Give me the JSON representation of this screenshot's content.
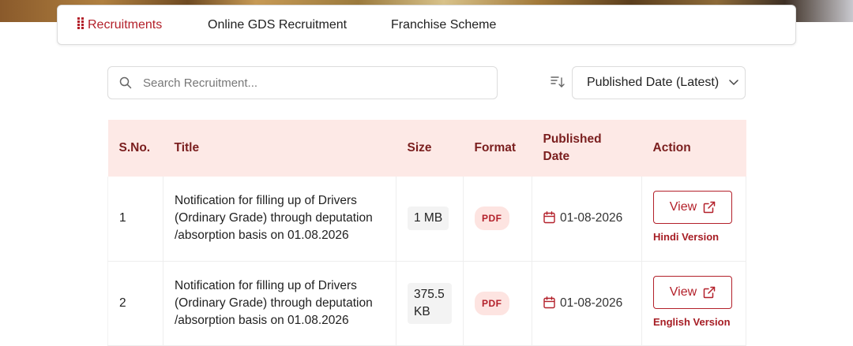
{
  "tabs": [
    {
      "label": "Recruitments",
      "active": true
    },
    {
      "label": "Online GDS Recruitment",
      "active": false
    },
    {
      "label": "Franchise Scheme",
      "active": false
    }
  ],
  "search": {
    "placeholder": "Search Recruitment...",
    "value": ""
  },
  "sort": {
    "selected": "Published Date (Latest)"
  },
  "table": {
    "headers": {
      "sno": "S.No.",
      "title": "Title",
      "size": "Size",
      "format": "Format",
      "published_date": "Published Date",
      "action": "Action"
    },
    "rows": [
      {
        "sno": "1",
        "title": "Notification for filling up of Drivers (Ordinary Grade) through deputation /absorption basis on 01.08.2026",
        "size": "1 MB",
        "format": "PDF",
        "date": "01-08-2026",
        "action_label": "View",
        "version": "Hindi Version"
      },
      {
        "sno": "2",
        "title": "Notification for filling up of Drivers (Ordinary Grade) through deputation /absorption basis on 01.08.2026",
        "size": "375.5 KB",
        "format": "PDF",
        "date": "01-08-2026",
        "action_label": "View",
        "version": "English Version"
      }
    ]
  },
  "colors": {
    "accent": "#b3202a",
    "header_bg": "#fde9e6",
    "header_text": "#7a1e1e"
  }
}
